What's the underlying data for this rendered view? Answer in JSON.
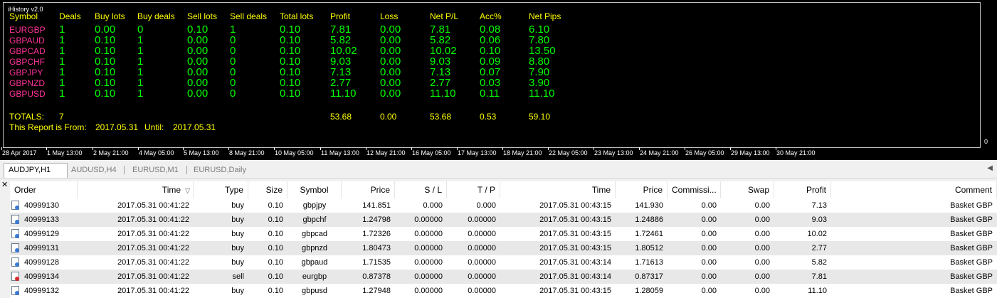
{
  "chart": {
    "indicator_name": "iHistory v2.0",
    "scale_top": "",
    "scale_bottom": "0",
    "headers": [
      "Symbol",
      "Deals",
      "Buy lots",
      "Buy deals",
      "Sell lots",
      "Sell deals",
      "Total lots",
      "Profit",
      "Loss",
      "Net P/L",
      "Acc%",
      "Net Pips"
    ],
    "rows": [
      {
        "symbol": "EURGBP",
        "deals": "1",
        "buy_lots": "0.00",
        "buy_deals": "0",
        "sell_lots": "0.10",
        "sell_deals": "1",
        "total_lots": "0.10",
        "profit": "7.81",
        "loss": "0.00",
        "net_pl": "7.81",
        "acc": "0.08",
        "net_pips": "6.10"
      },
      {
        "symbol": "GBPAUD",
        "deals": "1",
        "buy_lots": "0.10",
        "buy_deals": "1",
        "sell_lots": "0.00",
        "sell_deals": "0",
        "total_lots": "0.10",
        "profit": "5.82",
        "loss": "0.00",
        "net_pl": "5.82",
        "acc": "0.06",
        "net_pips": "7.80"
      },
      {
        "symbol": "GBPCAD",
        "deals": "1",
        "buy_lots": "0.10",
        "buy_deals": "1",
        "sell_lots": "0.00",
        "sell_deals": "0",
        "total_lots": "0.10",
        "profit": "10.02",
        "loss": "0.00",
        "net_pl": "10.02",
        "acc": "0.10",
        "net_pips": "13.50"
      },
      {
        "symbol": "GBPCHF",
        "deals": "1",
        "buy_lots": "0.10",
        "buy_deals": "1",
        "sell_lots": "0.00",
        "sell_deals": "0",
        "total_lots": "0.10",
        "profit": "9.03",
        "loss": "0.00",
        "net_pl": "9.03",
        "acc": "0.09",
        "net_pips": "8.80"
      },
      {
        "symbol": "GBPJPY",
        "deals": "1",
        "buy_lots": "0.10",
        "buy_deals": "1",
        "sell_lots": "0.00",
        "sell_deals": "0",
        "total_lots": "0.10",
        "profit": "7.13",
        "loss": "0.00",
        "net_pl": "7.13",
        "acc": "0.07",
        "net_pips": "7.90"
      },
      {
        "symbol": "GBPNZD",
        "deals": "1",
        "buy_lots": "0.10",
        "buy_deals": "1",
        "sell_lots": "0.00",
        "sell_deals": "0",
        "total_lots": "0.10",
        "profit": "2.77",
        "loss": "0.00",
        "net_pl": "2.77",
        "acc": "0.03",
        "net_pips": "3.90"
      },
      {
        "symbol": "GBPUSD",
        "deals": "1",
        "buy_lots": "0.10",
        "buy_deals": "1",
        "sell_lots": "0.00",
        "sell_deals": "0",
        "total_lots": "0.10",
        "profit": "11.10",
        "loss": "0.00",
        "net_pl": "11.10",
        "acc": "0.11",
        "net_pips": "11.10"
      }
    ],
    "totals": {
      "label": "TOTALS:",
      "deals": "7",
      "profit": "53.68",
      "loss": "0.00",
      "net_pl": "53.68",
      "acc": "0.53",
      "net_pips": "59.10"
    },
    "report": {
      "from_label": "This Report is From:",
      "from": "2017.05.31",
      "until_label": "Until:",
      "until": "2017.05.31"
    },
    "time_labels": [
      "28 Apr 2017",
      "1 May 13:00",
      "2 May 21:00",
      "4 May 05:00",
      "5 May 13:00",
      "8 May 21:00",
      "10 May 05:00",
      "11 May 13:00",
      "12 May 21:00",
      "16 May 05:00",
      "17 May 13:00",
      "18 May 21:00",
      "22 May 05:00",
      "23 May 13:00",
      "24 May 21:00",
      "26 May 05:00",
      "29 May 13:00",
      "30 May 21:00"
    ]
  },
  "tabs": [
    {
      "label": "AUDJPY,H1",
      "active": true
    },
    {
      "label": "AUDUSD,H4",
      "active": false
    },
    {
      "label": "EURUSD,M1",
      "active": false
    },
    {
      "label": "EURUSD,Daily",
      "active": false
    }
  ],
  "table": {
    "columns": [
      "Order",
      "Time",
      "Type",
      "Size",
      "Symbol",
      "Price",
      "S / L",
      "T / P",
      "Time",
      "Price",
      "Commissi...",
      "Swap",
      "Profit",
      "Comment"
    ],
    "sort_indicator": "▽",
    "rows": [
      {
        "order": "40999130",
        "time": "2017.05.31 00:41:22",
        "type": "buy",
        "size": "0.10",
        "symbol": "gbpjpy",
        "price": "141.851",
        "sl": "0.000",
        "tp": "0.000",
        "close_time": "2017.05.31 00:43:15",
        "close_price": "141.930",
        "commission": "0.00",
        "swap": "0.00",
        "profit": "7.13",
        "comment": "Basket GBP",
        "kind": "buy"
      },
      {
        "order": "40999133",
        "time": "2017.05.31 00:41:22",
        "type": "buy",
        "size": "0.10",
        "symbol": "gbpchf",
        "price": "1.24798",
        "sl": "0.00000",
        "tp": "0.00000",
        "close_time": "2017.05.31 00:43:15",
        "close_price": "1.24886",
        "commission": "0.00",
        "swap": "0.00",
        "profit": "9.03",
        "comment": "Basket GBP",
        "kind": "buy"
      },
      {
        "order": "40999129",
        "time": "2017.05.31 00:41:22",
        "type": "buy",
        "size": "0.10",
        "symbol": "gbpcad",
        "price": "1.72326",
        "sl": "0.00000",
        "tp": "0.00000",
        "close_time": "2017.05.31 00:43:15",
        "close_price": "1.72461",
        "commission": "0.00",
        "swap": "0.00",
        "profit": "10.02",
        "comment": "Basket GBP",
        "kind": "buy"
      },
      {
        "order": "40999131",
        "time": "2017.05.31 00:41:22",
        "type": "buy",
        "size": "0.10",
        "symbol": "gbpnzd",
        "price": "1.80473",
        "sl": "0.00000",
        "tp": "0.00000",
        "close_time": "2017.05.31 00:43:15",
        "close_price": "1.80512",
        "commission": "0.00",
        "swap": "0.00",
        "profit": "2.77",
        "comment": "Basket GBP",
        "kind": "buy"
      },
      {
        "order": "40999128",
        "time": "2017.05.31 00:41:22",
        "type": "buy",
        "size": "0.10",
        "symbol": "gbpaud",
        "price": "1.71535",
        "sl": "0.00000",
        "tp": "0.00000",
        "close_time": "2017.05.31 00:43:14",
        "close_price": "1.71613",
        "commission": "0.00",
        "swap": "0.00",
        "profit": "5.82",
        "comment": "Basket GBP",
        "kind": "buy"
      },
      {
        "order": "40999134",
        "time": "2017.05.31 00:41:22",
        "type": "sell",
        "size": "0.10",
        "symbol": "eurgbp",
        "price": "0.87378",
        "sl": "0.00000",
        "tp": "0.00000",
        "close_time": "2017.05.31 00:43:14",
        "close_price": "0.87317",
        "commission": "0.00",
        "swap": "0.00",
        "profit": "7.81",
        "comment": "Basket GBP",
        "kind": "sell"
      },
      {
        "order": "40999132",
        "time": "2017.05.31 00:41:22",
        "type": "buy",
        "size": "0.10",
        "symbol": "gbpusd",
        "price": "1.27948",
        "sl": "0.00000",
        "tp": "0.00000",
        "close_time": "2017.05.31 00:43:15",
        "close_price": "1.28059",
        "commission": "0.00",
        "swap": "0.00",
        "profit": "11.10",
        "comment": "Basket GBP",
        "kind": "buy"
      }
    ]
  },
  "colors": {
    "header_yellow": "#ffff00",
    "symbol_pink": "#ff3399",
    "value_green": "#00ff00",
    "buy_icon": "#3a7bd5",
    "sell_icon": "#d62b2b"
  }
}
